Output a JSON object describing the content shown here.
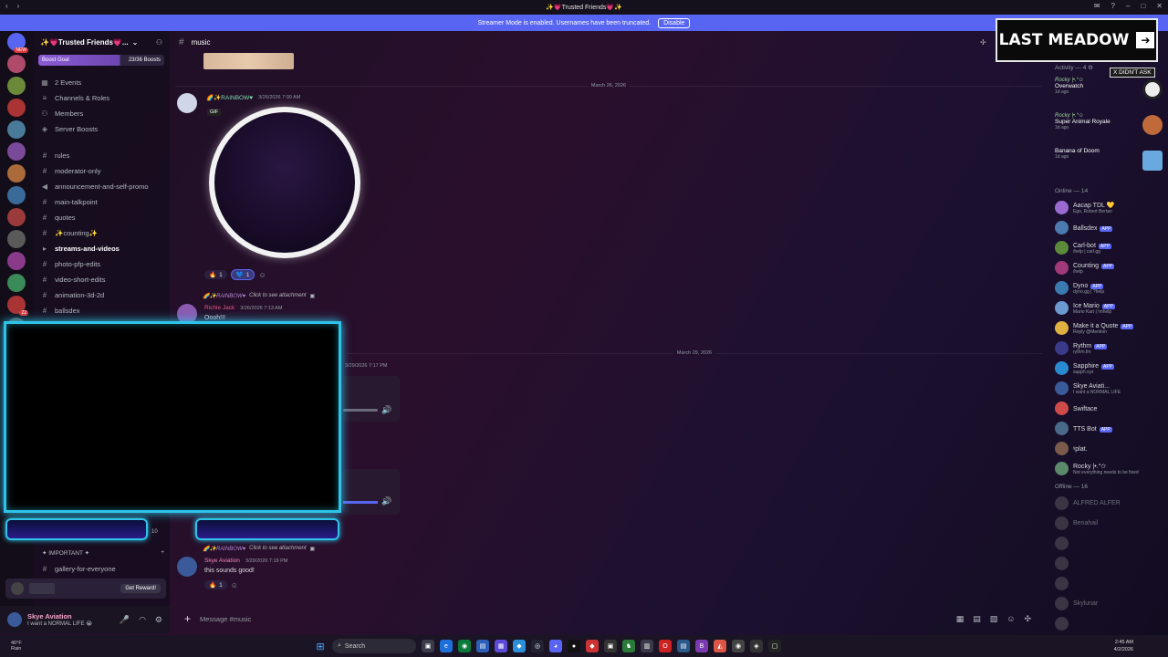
{
  "window": {
    "title": "✨💗Trusted Friends💗✨"
  },
  "streamer_bar": {
    "text": "Streamer Mode is enabled. Usernames have been truncated.",
    "disable_label": "Disable"
  },
  "rail": {
    "new_badge": "NEW",
    "badges": [
      "22",
      "9K",
      "10"
    ]
  },
  "guild": {
    "name": "✨💗Trusted Friends💗...",
    "boost_goal": "Boost Goal",
    "boost_count": "23/36 Boosts",
    "items": [
      {
        "icon": "calendar-icon",
        "label": "2 Events"
      },
      {
        "icon": "list-icon",
        "label": "Channels & Roles"
      },
      {
        "icon": "members-icon",
        "label": "Members"
      },
      {
        "icon": "boost-icon",
        "label": "Server Boosts"
      }
    ],
    "channels": [
      {
        "label": "rules",
        "icon": "hash"
      },
      {
        "label": "moderator-only",
        "icon": "hash"
      },
      {
        "label": "announcement-and-self-promo",
        "icon": "hash"
      },
      {
        "label": "main-talkpoint",
        "icon": "hash"
      },
      {
        "label": "quotes",
        "icon": "hash"
      },
      {
        "label": "✨counting✨",
        "icon": "hash"
      },
      {
        "label": "streams-and-videos",
        "icon": "hash",
        "active": true
      },
      {
        "label": "photo-pfp-edits",
        "icon": "hash"
      },
      {
        "label": "video-short-edits",
        "icon": "hash"
      },
      {
        "label": "animation-3d-2d",
        "icon": "hash"
      },
      {
        "label": "ballsdex",
        "icon": "hash"
      }
    ],
    "category_important": "✦ IMPORTANT ✦",
    "channel_bottom": "gallery-for-everyone",
    "reward_label": "Get Reward!"
  },
  "user": {
    "name": "Skye Aviation",
    "status": "I want a NORMAL LIFE 😭"
  },
  "chat": {
    "channel": "music",
    "date1": "March 26, 2026",
    "msg1": {
      "name": "🌈✨RAINBOW♥",
      "time": "3/26/2026 7:00 AM",
      "gif_label": "GIF"
    },
    "reactions1": [
      {
        "emoji": "🔥",
        "count": "1"
      },
      {
        "emoji": "💙",
        "count": "1"
      }
    ],
    "reply_line": "Click to see attachment",
    "msg2": {
      "name": "Richie Jack",
      "time": "3/26/2026 7:13 AM",
      "text": "Oooh!!!"
    },
    "date2": "March 29, 2026",
    "msg3": {
      "time": "3/29/2026 7:17 PM"
    },
    "msg4": {
      "name": "Skye Aviation",
      "time": "3/29/2026 7:19 PM",
      "text": "this sounds good!"
    },
    "reactions4": [
      {
        "emoji": "🔥",
        "count": "1"
      }
    ],
    "composer_placeholder": "Message #music"
  },
  "overlay": {
    "logo": "LAST MEADOW",
    "tag": "X DIDN'T ASK"
  },
  "members": {
    "activity_header": "Activity — 4",
    "activity": [
      {
        "user": "Rocky |•.°✩",
        "game": "Overwatch",
        "time": "1d ago"
      },
      {
        "user": "Rocky |•.°✩",
        "game": "Super Animal Royale",
        "time": "1d ago"
      },
      {
        "user": "",
        "game": "Banana of Doom",
        "time": "1d ago"
      }
    ],
    "online_header": "Online — 14",
    "online": [
      {
        "name": "Aacap TDL 💛",
        "sub": "Ego, Robert Bertan",
        "app": false
      },
      {
        "name": "Ballsdex",
        "sub": "",
        "app": true
      },
      {
        "name": "Carl-bot",
        "sub": "/help | carl.gg",
        "app": true
      },
      {
        "name": "Counting",
        "sub": "/help",
        "app": true
      },
      {
        "name": "Dyno",
        "sub": "dyno.gg | ?help",
        "app": true
      },
      {
        "name": "Ice Mario",
        "sub": "Mario Kart | !mhelp",
        "app": true
      },
      {
        "name": "Make it a Quote",
        "sub": "Reply @Mention",
        "app": true
      },
      {
        "name": "Rythm",
        "sub": "rythm.fm",
        "app": true
      },
      {
        "name": "Sapphire",
        "sub": "sapph.xyz",
        "app": true
      },
      {
        "name": "Skye Aviati...",
        "sub": "I want a NORMAL LIFE",
        "app": false
      },
      {
        "name": "Swiftace",
        "sub": "",
        "app": false
      },
      {
        "name": "TTS Bot",
        "sub": "",
        "app": true
      },
      {
        "name": "ᵞplat.",
        "sub": "",
        "app": false
      },
      {
        "name": "Rocky |•.°✩",
        "sub": "Not everything needs to be fixed",
        "app": false
      }
    ],
    "offline_header": "Offline — 16",
    "offline": [
      {
        "name": "ALFRED ALFER"
      },
      {
        "name": "Benahail"
      },
      {
        "name": ""
      },
      {
        "name": ""
      },
      {
        "name": ""
      },
      {
        "name": "Skylunar"
      },
      {
        "name": ""
      }
    ],
    "app_label": "APP"
  },
  "taskbar": {
    "weather_temp": "40°F",
    "weather_desc": "Rain",
    "search": "Search",
    "time": "2:45 AM",
    "date": "4/2/2026"
  }
}
